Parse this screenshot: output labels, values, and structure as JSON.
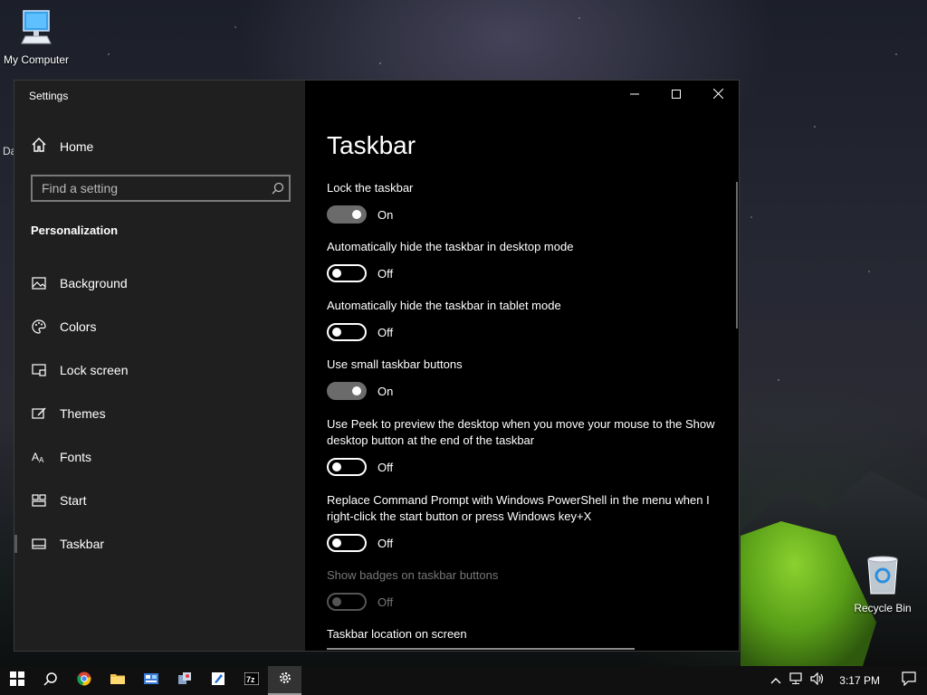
{
  "desktop": {
    "icons": [
      {
        "label": "My Computer",
        "icon": "computer-icon"
      },
      {
        "label": "Recycle Bin",
        "icon": "recycle-bin-icon"
      }
    ],
    "partial_label": "Da"
  },
  "settings": {
    "window_title": "Settings",
    "home_label": "Home",
    "search_placeholder": "Find a setting",
    "section_title": "Personalization",
    "nav": [
      {
        "label": "Background",
        "icon": "picture-icon"
      },
      {
        "label": "Colors",
        "icon": "palette-icon"
      },
      {
        "label": "Lock screen",
        "icon": "lock-screen-icon"
      },
      {
        "label": "Themes",
        "icon": "themes-icon"
      },
      {
        "label": "Fonts",
        "icon": "fonts-icon"
      },
      {
        "label": "Start",
        "icon": "start-layout-icon"
      },
      {
        "label": "Taskbar",
        "icon": "taskbar-icon",
        "active": true
      }
    ],
    "page_title": "Taskbar",
    "settings": [
      {
        "label": "Lock the taskbar",
        "state": "On"
      },
      {
        "label": "Automatically hide the taskbar in desktop mode",
        "state": "Off"
      },
      {
        "label": "Automatically hide the taskbar in tablet mode",
        "state": "Off"
      },
      {
        "label": "Use small taskbar buttons",
        "state": "On"
      },
      {
        "label": "Use Peek to preview the desktop when you move your mouse to the Show desktop button at the end of the taskbar",
        "state": "Off"
      },
      {
        "label": "Replace Command Prompt with Windows PowerShell in the menu when I right-click the start button or press Windows key+X",
        "state": "Off"
      },
      {
        "label": "Show badges on taskbar buttons",
        "state": "Off",
        "disabled": true
      }
    ],
    "location_label": "Taskbar location on screen"
  },
  "taskbar": {
    "apps": [
      "windows-start-icon",
      "search-icon",
      "chrome-icon",
      "file-explorer-icon",
      "control-panel-icon",
      "network-tool-icon",
      "paint-icon",
      "7zip-icon",
      "settings-gear-icon"
    ],
    "tray_icons": [
      "chevron-up-icon",
      "network-icon",
      "volume-icon"
    ],
    "time": "3:17 PM",
    "notification_icon": "action-center-icon"
  },
  "colors": {
    "sidebar_bg": "#1f1f1f",
    "content_bg": "#000000",
    "toggle_on": "#6b6b6b",
    "tent_green": "#8bd12f"
  }
}
